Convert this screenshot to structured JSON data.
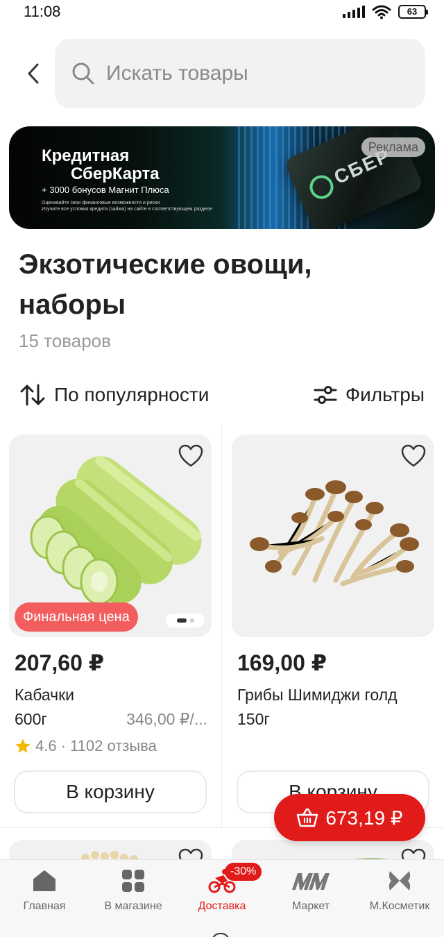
{
  "status_bar": {
    "time": "11:08",
    "battery": "63"
  },
  "search": {
    "placeholder": "Искать товары"
  },
  "banner": {
    "title_line1": "Кредитная",
    "title_line2": "СберКарта",
    "subtitle": "+ 3000 бонусов Магнит Плюса",
    "fine_print_1": "Оценивайте свои финансовые возможности и риски",
    "fine_print_2": "Изучите все условия кредита (займа) на сайте в соответствующем разделе",
    "ad_label": "Реклама",
    "card_brand": "СБЕР"
  },
  "category": {
    "title": "Экзотические овощи, наборы",
    "count": "15 товаров"
  },
  "toolbar": {
    "sort_label": "По популярности",
    "filter_label": "Фильтры"
  },
  "products": [
    {
      "price": "207,60 ₽",
      "name": "Кабачки",
      "weight": "600г",
      "unit_price": "346,00 ₽/...",
      "badge": "Финальная цена",
      "rating": "4.6",
      "reviews": "· 1102 отзыва",
      "cart_label": "В корзину"
    },
    {
      "price": "169,00 ₽",
      "name": "Грибы Шимиджи голд",
      "weight": "150г",
      "cart_label": "В корзину"
    }
  ],
  "floating_cart": {
    "total": "673,19 ₽"
  },
  "bottom_nav": {
    "items": [
      {
        "label": "Главная",
        "icon": "home-icon"
      },
      {
        "label": "В магазине",
        "icon": "grid-icon"
      },
      {
        "label": "Доставка",
        "icon": "delivery-icon",
        "badge": "-30%",
        "active": true
      },
      {
        "label": "Маркет",
        "icon": "market-logo-icon"
      },
      {
        "label": "М.Косметик",
        "icon": "cosmetic-logo-icon"
      }
    ]
  },
  "colors": {
    "accent": "#e11a1a",
    "badge_red": "#f25e5e",
    "text": "#222222",
    "muted": "#999999"
  }
}
